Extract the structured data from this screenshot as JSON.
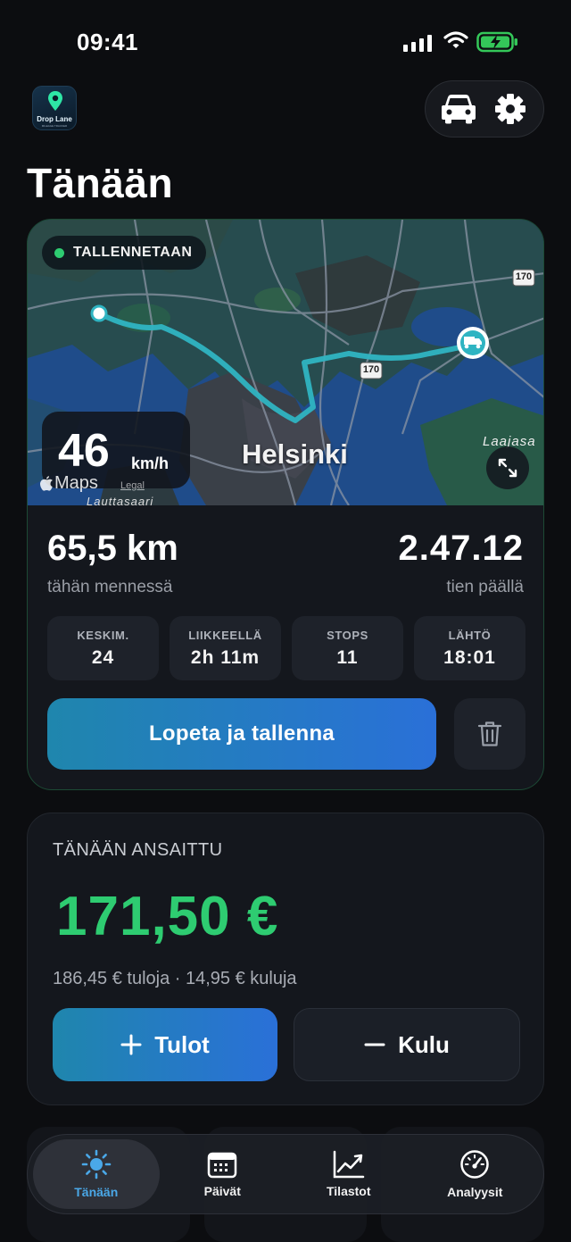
{
  "status_bar": {
    "time": "09:41"
  },
  "header": {
    "logo_text": "Drop Lane",
    "logo_subtext": "MILEAGE TRACKER",
    "title": "Tänään",
    "vehicle_icon": "car-icon",
    "settings_icon": "gear-icon"
  },
  "tracking": {
    "status_label": "TALLENNETAAN",
    "speed_value": "46",
    "speed_unit": "km/h",
    "map_city_label": "Helsinki",
    "map_place_labels": [
      "Laajasa",
      "Lauttasaari"
    ],
    "road_badge": "170",
    "maps_brand": "Maps",
    "maps_legal": "Legal",
    "distance_value": "65,5 km",
    "distance_label": "tähän mennessä",
    "duration_value": "2.47.12",
    "duration_label": "tien päällä",
    "stats": [
      {
        "label": "KESKIM.",
        "value": "24"
      },
      {
        "label": "LIIKKEELLÄ",
        "value": "2h 11m"
      },
      {
        "label": "STOPS",
        "value": "11"
      },
      {
        "label": "LÄHTÖ",
        "value": "18:01"
      }
    ],
    "stop_button": "Lopeta ja tallenna"
  },
  "earnings": {
    "title": "TÄNÄÄN ANSAITTU",
    "amount": "171,50 €",
    "breakdown": "186,45 € tuloja · 14,95 € kuluja",
    "income_button": "Tulot",
    "expense_button": "Kulu"
  },
  "tabs": [
    {
      "label": "Tänään",
      "icon": "sun-icon",
      "active": true
    },
    {
      "label": "Päivät",
      "icon": "calendar-icon",
      "active": false
    },
    {
      "label": "Tilastot",
      "icon": "trend-chart-icon",
      "active": false
    },
    {
      "label": "Analyysit",
      "icon": "gauge-icon",
      "active": false
    }
  ],
  "colors": {
    "background": "#0c0d10",
    "card": "#14171d",
    "accent_green": "#2ecc71",
    "accent_blue": "#2a70d8",
    "accent_teal": "#1f86ad",
    "active_tab": "#4aa8e8"
  }
}
